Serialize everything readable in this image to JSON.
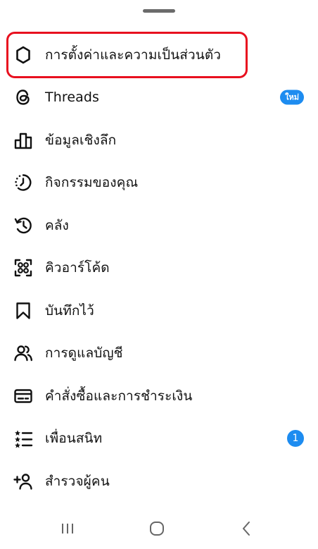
{
  "menu": {
    "items": [
      {
        "label": "การตั้งค่าและความเป็นส่วนตัว",
        "icon": "gear-icon"
      },
      {
        "label": "Threads",
        "icon": "threads-icon",
        "badge": "ใหม่"
      },
      {
        "label": "ข้อมูลเชิงลึก",
        "icon": "bar-chart-icon"
      },
      {
        "label": "กิจกรรมของคุณ",
        "icon": "activity-clock-icon"
      },
      {
        "label": "คลัง",
        "icon": "archive-history-icon"
      },
      {
        "label": "คิวอาร์โค้ด",
        "icon": "qr-code-icon"
      },
      {
        "label": "บันทึกไว้",
        "icon": "bookmark-icon"
      },
      {
        "label": "การดูแลบัญชี",
        "icon": "supervision-icon"
      },
      {
        "label": "คำสั่งซื้อและการชำระเงิน",
        "icon": "card-icon"
      },
      {
        "label": "เพื่อนสนิท",
        "icon": "close-friends-list-icon",
        "badge": "1"
      },
      {
        "label": "สำรวจผู้คน",
        "icon": "add-person-icon"
      }
    ]
  },
  "colors": {
    "highlight": "#e8101f",
    "badge": "#1d8cf0"
  },
  "navbar": {
    "items": [
      "recent-apps-icon",
      "home-icon",
      "back-icon"
    ]
  }
}
